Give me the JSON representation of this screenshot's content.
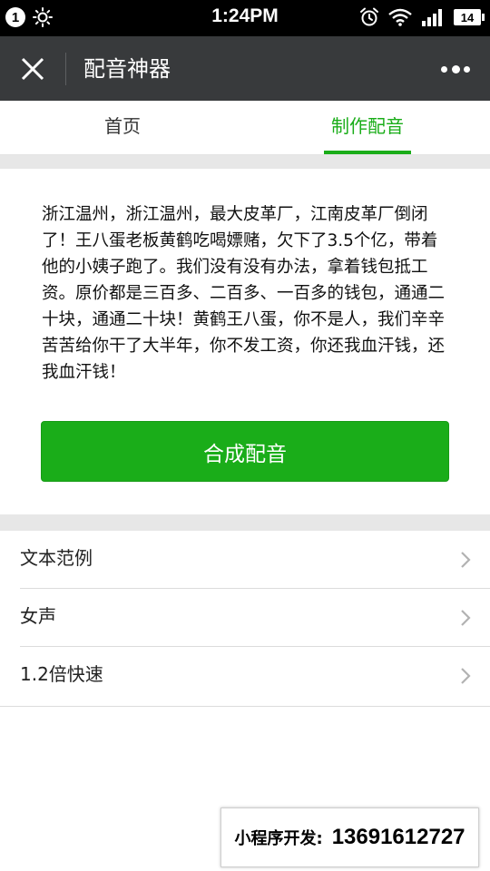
{
  "statusbar": {
    "notification_count": "1",
    "time": "1:24PM",
    "battery": "14"
  },
  "navbar": {
    "title": "配音神器",
    "close_icon": "close-icon",
    "more_icon": "more-icon"
  },
  "tabs": [
    {
      "label": "首页",
      "active": false
    },
    {
      "label": "制作配音",
      "active": true
    }
  ],
  "content": {
    "text": "浙江温州，浙江温州，最大皮革厂，江南皮革厂倒闭了！王八蛋老板黄鹤吃喝嫖赌，欠下了3.5个亿，带着他的小姨子跑了。我们没有没有办法，拿着钱包抵工资。原价都是三百多、二百多、一百多的钱包，通通二十块，通通二十块！黄鹤王八蛋，你不是人，我们辛辛苦苦给你干了大半年，你不发工资，你还我血汗钱，还我血汗钱！",
    "button_label": "合成配音"
  },
  "settings": [
    {
      "label": "文本范例"
    },
    {
      "label": "女声"
    },
    {
      "label": "1.2倍快速"
    }
  ],
  "promo": {
    "label": "小程序开发:",
    "phone": "13691612727"
  },
  "colors": {
    "accent": "#1aad19",
    "navbar": "#383a3c",
    "separator": "#e7e7e7"
  }
}
